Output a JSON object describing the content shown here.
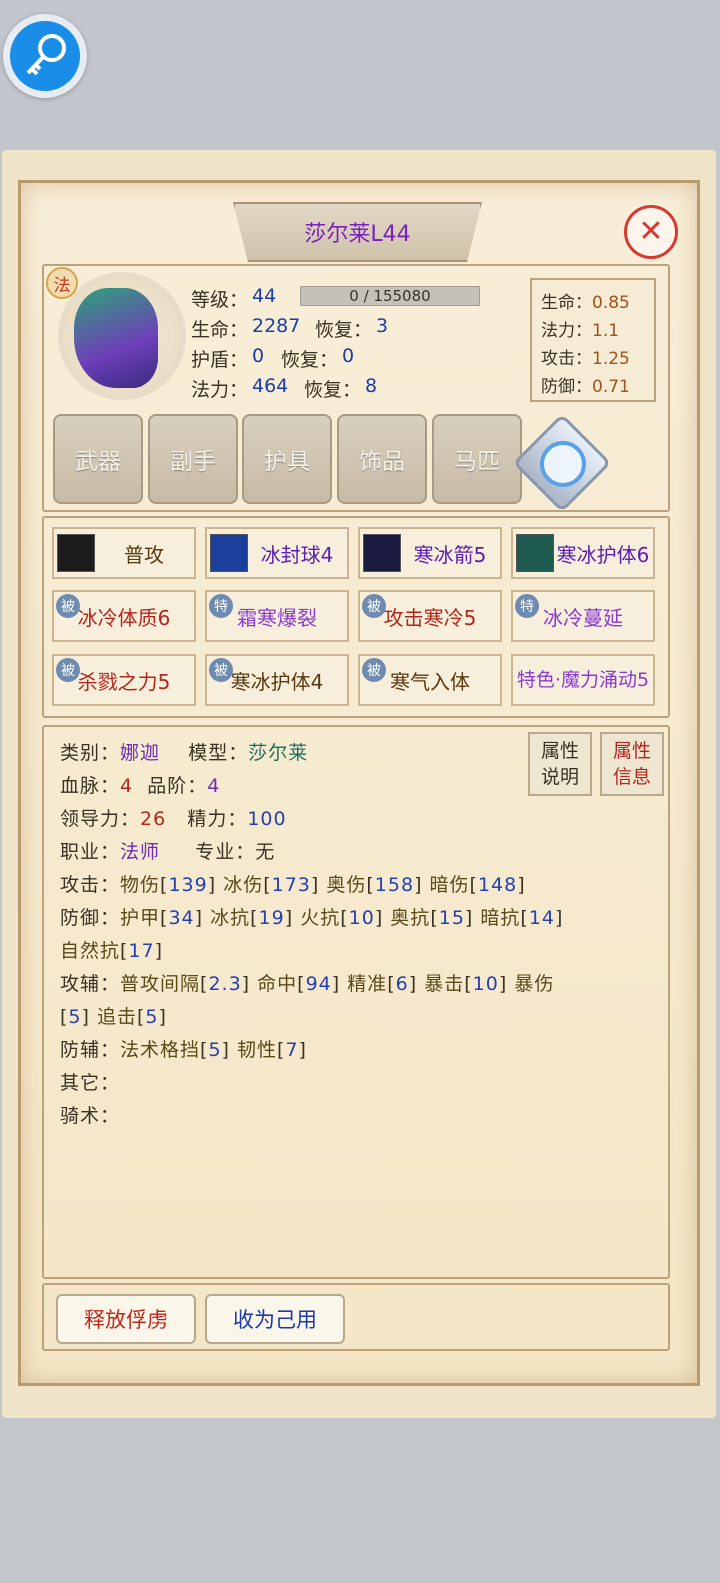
{
  "title": "莎尔莱L44",
  "class_badge": "法",
  "stats": {
    "level_label": "等级：",
    "level": "44",
    "exp": "0 / 155080",
    "hp_label": "生命：",
    "hp": "2287",
    "hp_regen_label": "恢复：",
    "hp_regen": "3",
    "shield_label": "护盾：",
    "shield": "0",
    "shield_regen_label": "恢复：",
    "shield_regen": "0",
    "mp_label": "法力：",
    "mp": "464",
    "mp_regen_label": "恢复：",
    "mp_regen": "8"
  },
  "growth": [
    {
      "label": "生命：",
      "value": "0.85"
    },
    {
      "label": "法力：",
      "value": "1.1"
    },
    {
      "label": "攻击：",
      "value": "1.25"
    },
    {
      "label": "防御：",
      "value": "0.71"
    }
  ],
  "equipment": [
    "武器",
    "副手",
    "护具",
    "饰品",
    "马匹"
  ],
  "skills": [
    {
      "label": "普攻",
      "tag": "",
      "color": "#5a3a10",
      "icon": "sword-icon"
    },
    {
      "label": "冰封球4",
      "tag": "",
      "color": "#5a1fb0",
      "icon": "ice-orb-icon"
    },
    {
      "label": "寒冰箭5",
      "tag": "",
      "color": "#5a1fb0",
      "icon": "ice-arrow-icon"
    },
    {
      "label": "寒冰护体6",
      "tag": "",
      "color": "#5a1fb0",
      "icon": "ice-armor-icon"
    },
    {
      "label": "冰冷体质6",
      "tag": "被",
      "color": "#b3261e"
    },
    {
      "label": "霜寒爆裂",
      "tag": "特",
      "color": "#8a3ad0"
    },
    {
      "label": "攻击寒冷5",
      "tag": "被",
      "color": "#b3261e"
    },
    {
      "label": "冰冷蔓延",
      "tag": "特",
      "color": "#8a3ad0"
    },
    {
      "label": "杀戮之力5",
      "tag": "被",
      "color": "#b3261e"
    },
    {
      "label": "寒冰护体4",
      "tag": "被",
      "color": "#5a3a10"
    },
    {
      "label": "寒气入体",
      "tag": "被",
      "color": "#5a3a10"
    },
    {
      "label": "特色·魔力涌动5",
      "tag": "",
      "color": "#8a3ad0"
    }
  ],
  "info": {
    "type_label": "类别：",
    "type": "娜迦",
    "model_label": "模型：",
    "model": "莎尔莱",
    "blood_label": "血脉：",
    "blood": "4",
    "grade_label": "品阶：",
    "grade": "4",
    "lead_label": "领导力：",
    "lead": "26",
    "energy_label": "精力：",
    "energy": "100",
    "job_label": "职业：",
    "job": "法师",
    "spec_label": "专业：",
    "spec": "无",
    "atk_label": "攻击：",
    "def_label": "防御：",
    "atk_aux_label": "攻辅：",
    "def_aux_label": "防辅：",
    "other_label": "其它：",
    "ride_label": "骑术："
  },
  "attack": [
    {
      "n": "物伤",
      "v": "139"
    },
    {
      "n": "冰伤",
      "v": "173"
    },
    {
      "n": "奥伤",
      "v": "158"
    },
    {
      "n": "暗伤",
      "v": "148"
    }
  ],
  "defense": [
    {
      "n": "护甲",
      "v": "34"
    },
    {
      "n": "冰抗",
      "v": "19"
    },
    {
      "n": "火抗",
      "v": "10"
    },
    {
      "n": "奥抗",
      "v": "15"
    },
    {
      "n": "暗抗",
      "v": "14"
    },
    {
      "n": "自然抗",
      "v": "17"
    }
  ],
  "attack_aux": [
    {
      "n": "普攻间隔",
      "v": "2.3"
    },
    {
      "n": "命中",
      "v": "94"
    },
    {
      "n": "精准",
      "v": "6"
    },
    {
      "n": "暴击",
      "v": "10"
    },
    {
      "n": "暴伤",
      "v": "5"
    },
    {
      "n": "追击",
      "v": "5"
    }
  ],
  "defense_aux": [
    {
      "n": "法术格挡",
      "v": "5"
    },
    {
      "n": "韧性",
      "v": "7"
    }
  ],
  "attr_buttons": [
    "属性说明",
    "属性信息"
  ],
  "actions": {
    "release": "释放俘虏",
    "recruit": "收为己用"
  }
}
